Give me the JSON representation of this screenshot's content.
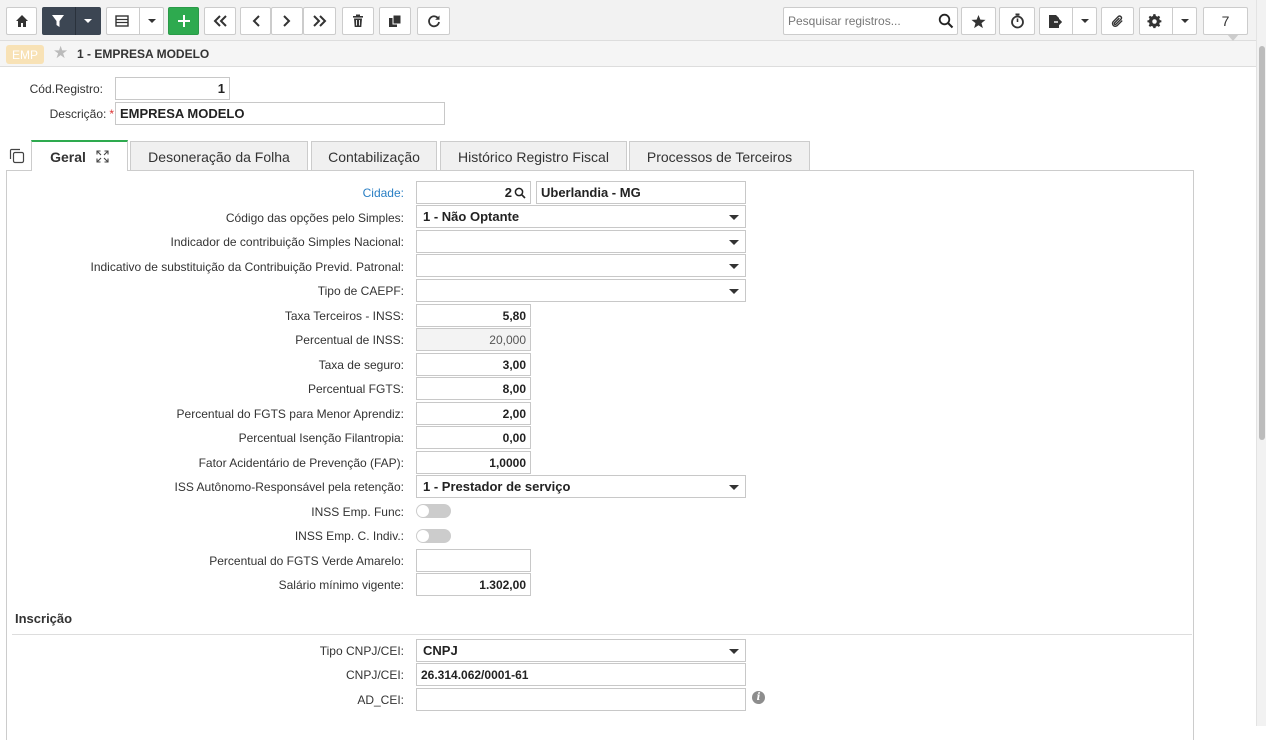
{
  "toolbar": {
    "search_placeholder": "Pesquisar registros...",
    "record_count": "7"
  },
  "breadcrumb": {
    "badge": "EMP",
    "title": "1 - EMPRESA MODELO"
  },
  "header": {
    "cod_label": "Cód.Registro:",
    "cod_value": "1",
    "desc_label": "Descrição:",
    "desc_required": "*",
    "desc_value": "EMPRESA MODELO"
  },
  "tabs": [
    "Geral",
    "Desoneração da Folha",
    "Contabilização",
    "Histórico Registro Fiscal",
    "Processos de Terceiros"
  ],
  "fields": {
    "cidade_label": "Cidade:",
    "cidade_code": "2",
    "cidade_name": "Uberlandia - MG",
    "simples_label": "Código das opções pelo Simples:",
    "simples_value": "1 - Não Optante",
    "ind_simples_label": "Indicador de contribuição Simples Nacional:",
    "ind_simples_value": "",
    "subst_label": "Indicativo de substituição da Contribuição Previd. Patronal:",
    "subst_value": "",
    "caepf_label": "Tipo de CAEPF:",
    "caepf_value": "",
    "taxa_terceiros_label": "Taxa Terceiros - INSS:",
    "taxa_terceiros_value": "5,80",
    "perc_inss_label": "Percentual de INSS:",
    "perc_inss_value": "20,000",
    "taxa_seguro_label": "Taxa de seguro:",
    "taxa_seguro_value": "3,00",
    "perc_fgts_label": "Percentual FGTS:",
    "perc_fgts_value": "8,00",
    "fgts_menor_label": "Percentual do FGTS para Menor Aprendiz:",
    "fgts_menor_value": "2,00",
    "isencao_label": "Percentual Isenção Filantropia:",
    "isencao_value": "0,00",
    "fap_label": "Fator Acidentário de Prevenção (FAP):",
    "fap_value": "1,0000",
    "iss_label": "ISS Autônomo-Responsável pela retenção:",
    "iss_value": "1 - Prestador de serviço",
    "inss_func_label": "INSS Emp. Func:",
    "inss_func_on": false,
    "inss_cind_label": "INSS Emp. C. Indiv.:",
    "inss_cind_on": false,
    "fgts_verde_label": "Percentual do FGTS Verde Amarelo:",
    "fgts_verde_value": "",
    "salario_label": "Salário mínimo vigente:",
    "salario_value": "1.302,00"
  },
  "inscricao": {
    "section_title": "Inscrição",
    "tipo_label": "Tipo CNPJ/CEI:",
    "tipo_value": "CNPJ",
    "cnpj_label": "CNPJ/CEI:",
    "cnpj_value": "26.314.062/0001-61",
    "adcei_label": "AD_CEI:",
    "adcei_value": "",
    "info_icon": "i"
  }
}
